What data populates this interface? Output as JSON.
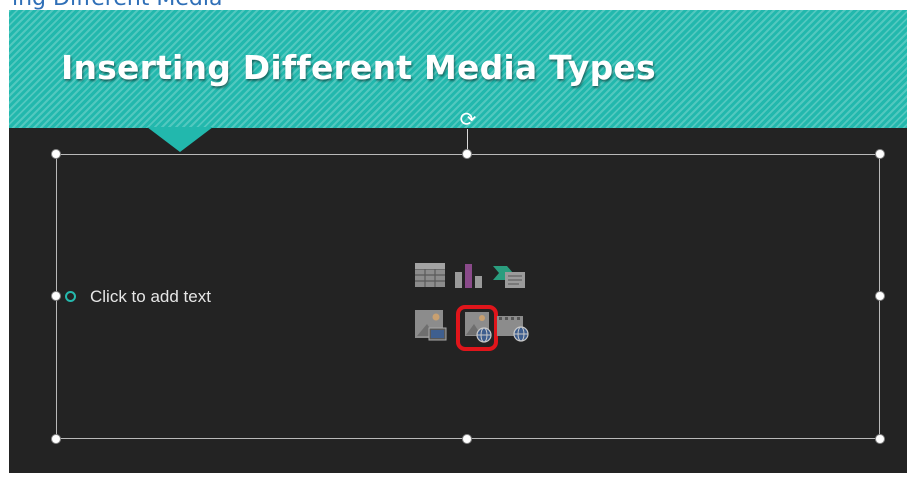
{
  "header": {
    "partial_text": "ing Different Media"
  },
  "slide": {
    "title": "Inserting Different Media Types",
    "placeholder": {
      "text": "Click to add text"
    }
  },
  "content_icons": [
    {
      "name": "insert-table-icon"
    },
    {
      "name": "insert-chart-icon"
    },
    {
      "name": "insert-smartart-icon"
    },
    {
      "name": "insert-picture-icon"
    },
    {
      "name": "insert-online-picture-icon",
      "highlighted": true
    },
    {
      "name": "insert-video-icon"
    }
  ],
  "colors": {
    "banner": "#22b8ad",
    "slide_background": "#232323",
    "highlight": "#e0151b",
    "bullet": "#25b9ad"
  }
}
